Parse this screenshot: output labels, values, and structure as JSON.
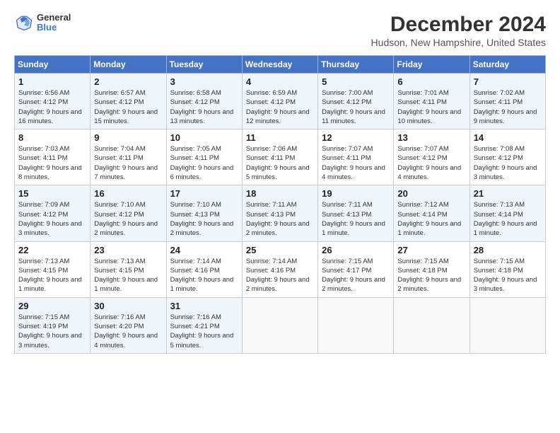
{
  "header": {
    "logo": {
      "general": "General",
      "blue": "Blue"
    },
    "title": "December 2024",
    "location": "Hudson, New Hampshire, United States"
  },
  "calendar": {
    "days_of_week": [
      "Sunday",
      "Monday",
      "Tuesday",
      "Wednesday",
      "Thursday",
      "Friday",
      "Saturday"
    ],
    "weeks": [
      [
        {
          "day": "1",
          "sunrise": "6:56 AM",
          "sunset": "4:12 PM",
          "daylight": "9 hours and 16 minutes."
        },
        {
          "day": "2",
          "sunrise": "6:57 AM",
          "sunset": "4:12 PM",
          "daylight": "9 hours and 15 minutes."
        },
        {
          "day": "3",
          "sunrise": "6:58 AM",
          "sunset": "4:12 PM",
          "daylight": "9 hours and 13 minutes."
        },
        {
          "day": "4",
          "sunrise": "6:59 AM",
          "sunset": "4:12 PM",
          "daylight": "9 hours and 12 minutes."
        },
        {
          "day": "5",
          "sunrise": "7:00 AM",
          "sunset": "4:12 PM",
          "daylight": "9 hours and 11 minutes."
        },
        {
          "day": "6",
          "sunrise": "7:01 AM",
          "sunset": "4:11 PM",
          "daylight": "9 hours and 10 minutes."
        },
        {
          "day": "7",
          "sunrise": "7:02 AM",
          "sunset": "4:11 PM",
          "daylight": "9 hours and 9 minutes."
        }
      ],
      [
        {
          "day": "8",
          "sunrise": "7:03 AM",
          "sunset": "4:11 PM",
          "daylight": "9 hours and 8 minutes."
        },
        {
          "day": "9",
          "sunrise": "7:04 AM",
          "sunset": "4:11 PM",
          "daylight": "9 hours and 7 minutes."
        },
        {
          "day": "10",
          "sunrise": "7:05 AM",
          "sunset": "4:11 PM",
          "daylight": "9 hours and 6 minutes."
        },
        {
          "day": "11",
          "sunrise": "7:06 AM",
          "sunset": "4:11 PM",
          "daylight": "9 hours and 5 minutes."
        },
        {
          "day": "12",
          "sunrise": "7:07 AM",
          "sunset": "4:11 PM",
          "daylight": "9 hours and 4 minutes."
        },
        {
          "day": "13",
          "sunrise": "7:07 AM",
          "sunset": "4:12 PM",
          "daylight": "9 hours and 4 minutes."
        },
        {
          "day": "14",
          "sunrise": "7:08 AM",
          "sunset": "4:12 PM",
          "daylight": "9 hours and 3 minutes."
        }
      ],
      [
        {
          "day": "15",
          "sunrise": "7:09 AM",
          "sunset": "4:12 PM",
          "daylight": "9 hours and 3 minutes."
        },
        {
          "day": "16",
          "sunrise": "7:10 AM",
          "sunset": "4:12 PM",
          "daylight": "9 hours and 2 minutes."
        },
        {
          "day": "17",
          "sunrise": "7:10 AM",
          "sunset": "4:13 PM",
          "daylight": "9 hours and 2 minutes."
        },
        {
          "day": "18",
          "sunrise": "7:11 AM",
          "sunset": "4:13 PM",
          "daylight": "9 hours and 2 minutes."
        },
        {
          "day": "19",
          "sunrise": "7:11 AM",
          "sunset": "4:13 PM",
          "daylight": "9 hours and 1 minute."
        },
        {
          "day": "20",
          "sunrise": "7:12 AM",
          "sunset": "4:14 PM",
          "daylight": "9 hours and 1 minute."
        },
        {
          "day": "21",
          "sunrise": "7:13 AM",
          "sunset": "4:14 PM",
          "daylight": "9 hours and 1 minute."
        }
      ],
      [
        {
          "day": "22",
          "sunrise": "7:13 AM",
          "sunset": "4:15 PM",
          "daylight": "9 hours and 1 minute."
        },
        {
          "day": "23",
          "sunrise": "7:13 AM",
          "sunset": "4:15 PM",
          "daylight": "9 hours and 1 minute."
        },
        {
          "day": "24",
          "sunrise": "7:14 AM",
          "sunset": "4:16 PM",
          "daylight": "9 hours and 1 minute."
        },
        {
          "day": "25",
          "sunrise": "7:14 AM",
          "sunset": "4:16 PM",
          "daylight": "9 hours and 2 minutes."
        },
        {
          "day": "26",
          "sunrise": "7:15 AM",
          "sunset": "4:17 PM",
          "daylight": "9 hours and 2 minutes."
        },
        {
          "day": "27",
          "sunrise": "7:15 AM",
          "sunset": "4:18 PM",
          "daylight": "9 hours and 2 minutes."
        },
        {
          "day": "28",
          "sunrise": "7:15 AM",
          "sunset": "4:18 PM",
          "daylight": "9 hours and 3 minutes."
        }
      ],
      [
        {
          "day": "29",
          "sunrise": "7:15 AM",
          "sunset": "4:19 PM",
          "daylight": "9 hours and 3 minutes."
        },
        {
          "day": "30",
          "sunrise": "7:16 AM",
          "sunset": "4:20 PM",
          "daylight": "9 hours and 4 minutes."
        },
        {
          "day": "31",
          "sunrise": "7:16 AM",
          "sunset": "4:21 PM",
          "daylight": "9 hours and 5 minutes."
        },
        null,
        null,
        null,
        null
      ]
    ]
  }
}
